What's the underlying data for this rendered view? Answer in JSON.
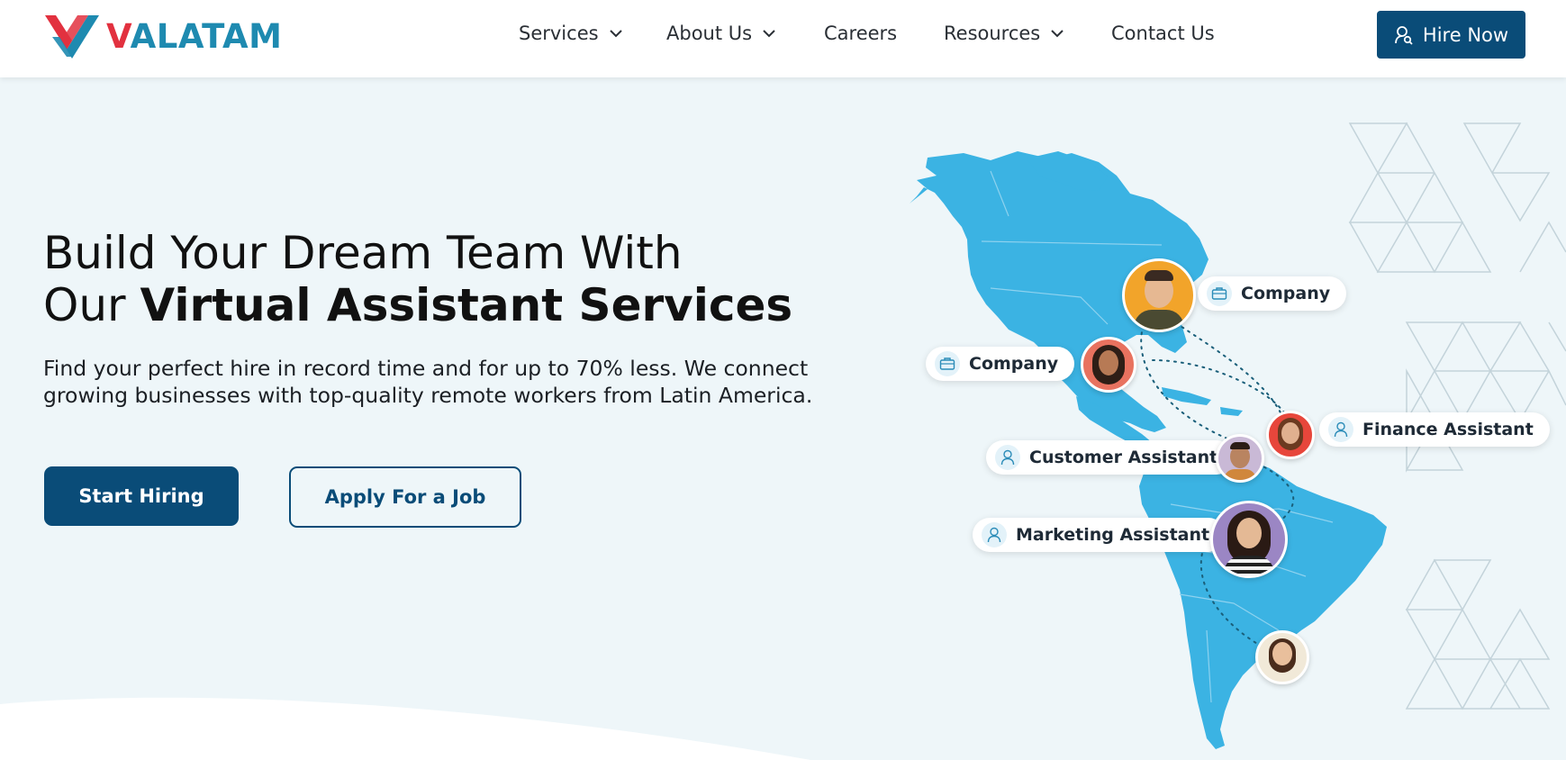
{
  "brand": {
    "logo_lead": "V",
    "logo_rest": "ALATAM",
    "primary_color": "#0a4c78",
    "accent_red": "#e2313f",
    "accent_blue": "#1e8ab0"
  },
  "nav": {
    "items": [
      {
        "label": "Services",
        "has_dropdown": true
      },
      {
        "label": "About Us",
        "has_dropdown": true
      },
      {
        "label": "Careers",
        "has_dropdown": false
      },
      {
        "label": "Resources",
        "has_dropdown": true
      },
      {
        "label": "Contact Us",
        "has_dropdown": false
      }
    ],
    "cta_label": "Hire Now"
  },
  "hero": {
    "title_line1": "Build Your Dream Team With",
    "title_line2_prefix": "Our ",
    "title_line2_bold": "Virtual Assistant Services",
    "subtitle": "Find your perfect hire in record time and for up to 70% less. We connect growing businesses with top-quality remote workers from Latin America.",
    "primary_button": "Start Hiring",
    "secondary_button": "Apply For a Job"
  },
  "map_labels": {
    "company_1": "Company",
    "company_2": "Company",
    "finance": "Finance Assistant",
    "customer": "Customer Assistant",
    "marketing": "Marketing Assistant"
  },
  "colors": {
    "map_fill": "#3bb3e3",
    "background": "#eef6f9"
  }
}
